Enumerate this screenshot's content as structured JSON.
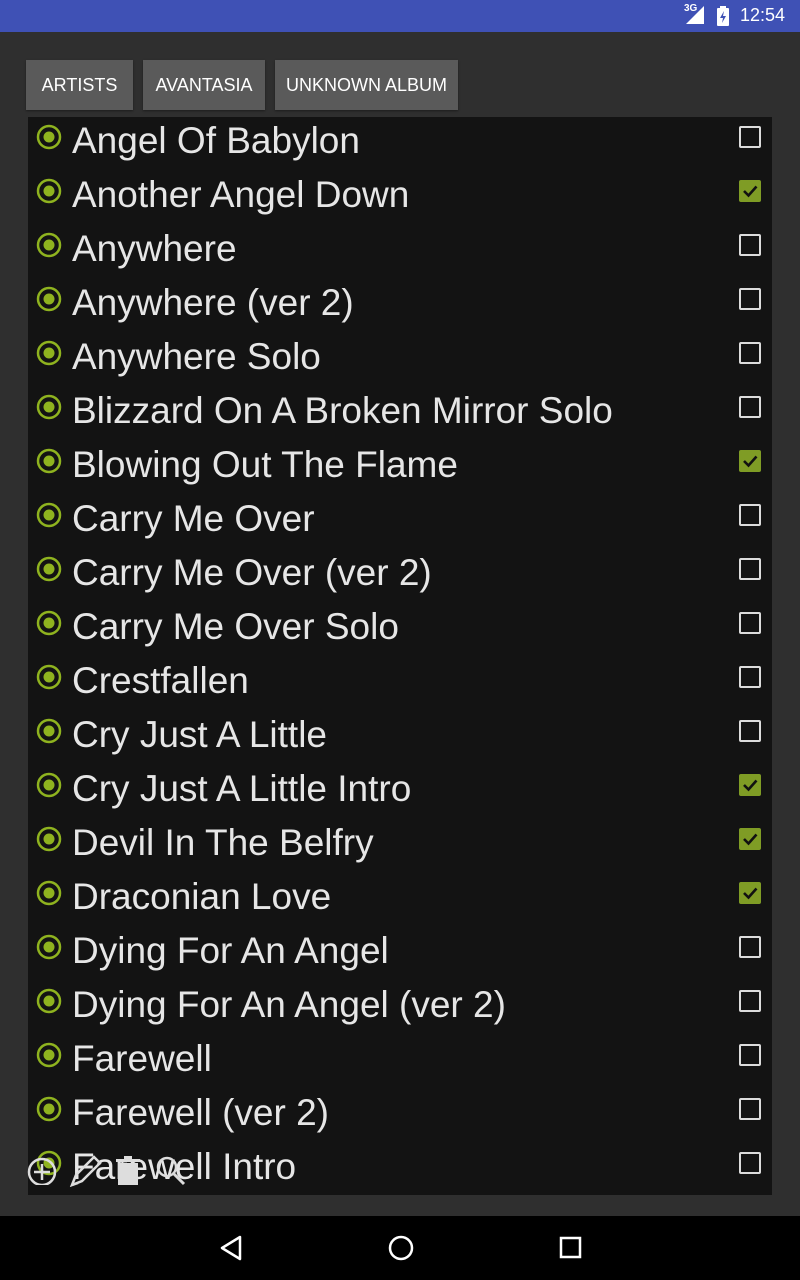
{
  "status_bar": {
    "network": "3G",
    "time": "12:54"
  },
  "breadcrumbs": [
    {
      "label": "ARTISTS"
    },
    {
      "label": "AVANTASIA"
    },
    {
      "label": "UNKNOWN ALBUM"
    }
  ],
  "tracks": [
    {
      "title": "Angel Of Babylon",
      "checked": false
    },
    {
      "title": "Another Angel Down",
      "checked": true
    },
    {
      "title": "Anywhere",
      "checked": false
    },
    {
      "title": "Anywhere (ver 2)",
      "checked": false
    },
    {
      "title": "Anywhere Solo",
      "checked": false
    },
    {
      "title": "Blizzard On A Broken Mirror Solo",
      "checked": false
    },
    {
      "title": "Blowing Out The Flame",
      "checked": true
    },
    {
      "title": "Carry Me Over",
      "checked": false
    },
    {
      "title": "Carry Me Over (ver 2)",
      "checked": false
    },
    {
      "title": "Carry Me Over Solo",
      "checked": false
    },
    {
      "title": "Crestfallen",
      "checked": false
    },
    {
      "title": "Cry Just A Little",
      "checked": false
    },
    {
      "title": "Cry Just A Little Intro",
      "checked": true
    },
    {
      "title": "Devil In The Belfry",
      "checked": true
    },
    {
      "title": "Draconian Love",
      "checked": true
    },
    {
      "title": "Dying For An Angel",
      "checked": false
    },
    {
      "title": "Dying For An Angel (ver 2)",
      "checked": false
    },
    {
      "title": "Farewell",
      "checked": false
    },
    {
      "title": "Farewell (ver 2)",
      "checked": false
    },
    {
      "title": "Farewell Intro",
      "checked": false
    }
  ],
  "toolbar_icons": [
    "add-icon",
    "edit-icon",
    "delete-icon",
    "search-icon"
  ],
  "nav_icons": [
    "back-icon",
    "home-icon",
    "recents-icon"
  ],
  "colors": {
    "status_bar": "#3f51b5",
    "accent_green": "#7f9c25",
    "radio_green": "#8fb31f",
    "list_bg": "#131313",
    "page_bg": "#2f2f2f",
    "crumb_bg": "#5a5a5a"
  }
}
